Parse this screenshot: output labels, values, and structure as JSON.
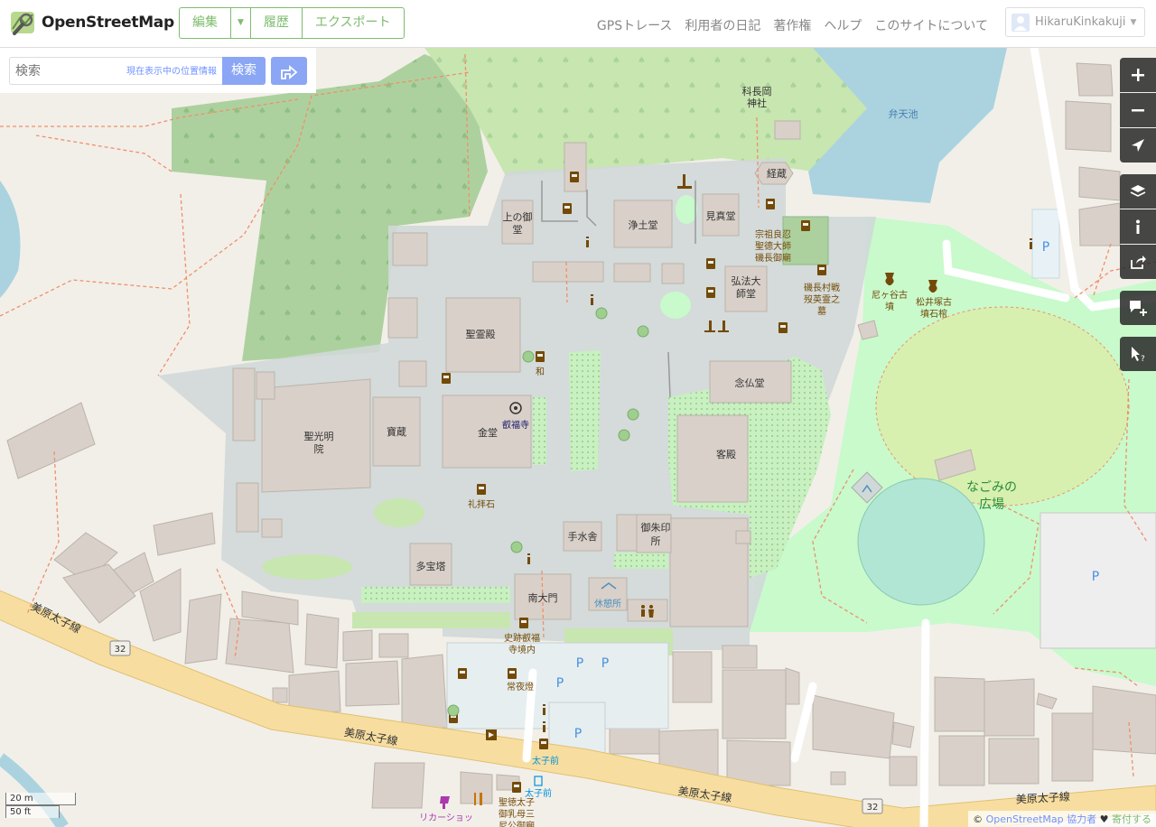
{
  "header": {
    "logo_text": "OpenStreetMap",
    "edit_label": "編集",
    "history_label": "履歴",
    "export_label": "エクスポート",
    "nav": [
      "GPSトレース",
      "利用者の日記",
      "著作権",
      "ヘルプ",
      "このサイトについて"
    ],
    "user_name": "HikaruKinkakuji"
  },
  "search": {
    "placeholder": "検索",
    "where_am_i": "現在表示中の位置情報",
    "button_label": "検索"
  },
  "map": {
    "labels": {
      "shinnyo": "科長岡",
      "jinja": "神社",
      "benten": "弁天池",
      "kyozo": "経蔵",
      "jodo": "浄土堂",
      "kenshin": "見真堂",
      "kami1": "上の御",
      "kami2": "堂",
      "shuso1": "宗祖良忍",
      "shuso2": "聖德大師",
      "shuso3": "磯長御廟",
      "kobo1": "弘法大",
      "kobo2": "師堂",
      "shikinaga1": "磯長村戦",
      "shikinaga2": "歿英霊之",
      "shikinaga3": "墓",
      "ama1": "尼ヶ谷古",
      "ama2": "墳",
      "matsui1": "松井塚古",
      "matsui2": "墳石棺",
      "seirei": "聖霊殿",
      "wa": "和",
      "nembutsu": "念仏堂",
      "eifukuji": "叡福寺",
      "kondo": "金堂",
      "hozo": "寶蔵",
      "shoko1": "聖光明",
      "shoko2": "院",
      "kyakuden": "客殿",
      "raihai": "礼拝石",
      "temizu": "手水舎",
      "goshuin1": "御朱印",
      "goshuin2": "所",
      "tahoto": "多宝塔",
      "nandai": "南大門",
      "kyukei": "休憩所",
      "shiseki1": "史跡叡福",
      "shiseki2": "寺境内",
      "jouyato": "常夜燈",
      "taishimae1": "太子前",
      "taishimae2": "太子前",
      "nagomi1": "なごみの",
      "nagomi2": "広場",
      "road1": "美原太子線",
      "road2": "美原太子線",
      "road3": "美原太子線",
      "road4": "美原太子線",
      "route1": "32",
      "route2": "32",
      "liquor": "リカーショッ",
      "shotoku1": "聖徳太子",
      "shotoku2": "御乳母三",
      "shotoku3": "尼公御廟",
      "p": "P"
    }
  },
  "scale": {
    "metric": "20 m",
    "imperial": "50 ft"
  },
  "attribution": {
    "copy": "©",
    "osm": "OpenStreetMap",
    "contrib": "協力者",
    "heart": "♥",
    "donate": "寄付する"
  }
}
